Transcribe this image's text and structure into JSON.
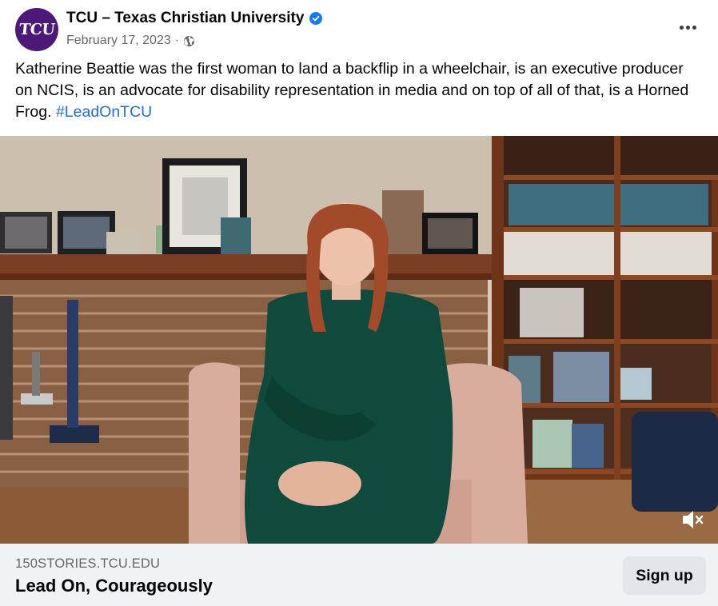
{
  "post": {
    "page_name": "TCU – Texas Christian University",
    "avatar_text": "TCU",
    "verified": true,
    "date": "February 17, 2023",
    "separator": "·",
    "audience_icon": "globe-icon",
    "more_icon": "more-horizontal-icon",
    "caption_text": "Katherine Beattie was the first woman to land a backflip in a wheelchair, is an executive producer on NCIS, is an advocate for disability representation in media and on top of all of that, is a Horned Frog. ",
    "hashtag": "#LeadOnTCU"
  },
  "video": {
    "mute_icon": "muted-speaker-icon"
  },
  "link_preview": {
    "domain": "150STORIES.TCU.EDU",
    "title": "Lead On, Courageously",
    "cta_label": "Sign up"
  },
  "colors": {
    "brand_purple": "#4d1979",
    "link_blue": "#216fdb",
    "verified_blue": "#1877f2",
    "secondary_text": "#65676b",
    "link_bar_bg": "#f0f2f5"
  }
}
